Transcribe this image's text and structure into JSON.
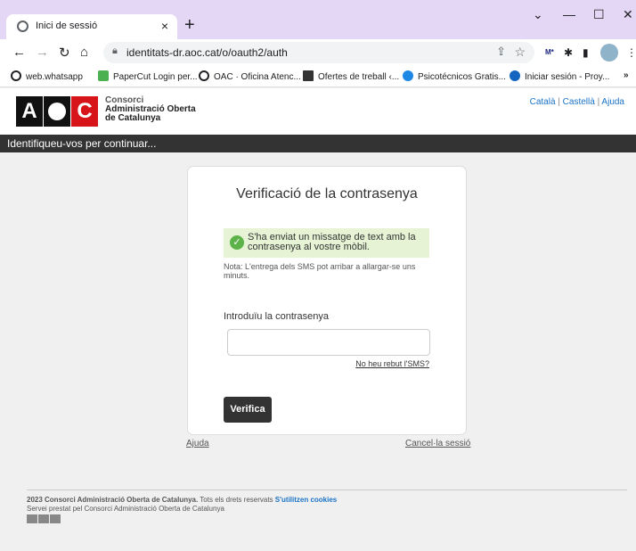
{
  "browser": {
    "tab_title": "Inici de sessió",
    "tab_close": "×",
    "new_tab": "+",
    "url": "identitats-dr.aoc.cat/o/oauth2/auth",
    "window_controls": {
      "minimize": "—",
      "maximize": "☐",
      "close": "✕",
      "tablist": "⌄"
    }
  },
  "bookmarks": [
    {
      "label": "web.whatsapp",
      "icon": "globe-icon",
      "color": "#202124"
    },
    {
      "label": "PaperCut Login per...",
      "icon": "papercut-icon",
      "color": "#4caf50"
    },
    {
      "label": "OAC · Oficina Atenc...",
      "icon": "globe-icon",
      "color": "#202124"
    },
    {
      "label": "Ofertes de treball ‹...",
      "icon": "job-icon",
      "color": "#333"
    },
    {
      "label": "Psicotécnicos Gratis...",
      "icon": "psico-icon",
      "color": "#1e88e5"
    },
    {
      "label": "Iniciar sesión - Proy...",
      "icon": "a-icon",
      "color": "#1565c0"
    }
  ],
  "header": {
    "logo_text": "AOC",
    "org_line1": "Consorci",
    "org_line2": "Administració Oberta",
    "org_line3": "de Catalunya",
    "lang_ca": "Català",
    "lang_es": "Castellà",
    "help": "Ajuda"
  },
  "bar_text": "Identifiqueu-vos per continuar...",
  "card": {
    "title": "Verificació de la contrasenya",
    "notice": "S'ha enviat un missatge de text amb la contrasenya al vostre mòbil.",
    "note": "Nota: L'entrega dels SMS pot arribar a allargar-se uns minuts.",
    "password_label": "Introduïu la contrasenya",
    "password_value": "",
    "no_sms_link": "No heu rebut l'SMS?",
    "verify_button": "Verifica"
  },
  "links": {
    "help": "Ajuda",
    "cancel": "Cancel·la sessió"
  },
  "footer": {
    "line1": "2023 Consorci Administració Oberta de Catalunya.",
    "line1b": " Tots els drets reservats ",
    "cookies": "S'utilitzen cookies",
    "line2": "Servei prestat pel Consorci Administració Oberta de Catalunya"
  },
  "colors": {
    "accent_red": "#d7141a",
    "link_blue": "#1a73c7",
    "tab_strip": "#e4d7f5",
    "success_bg": "#e6f4d5"
  }
}
